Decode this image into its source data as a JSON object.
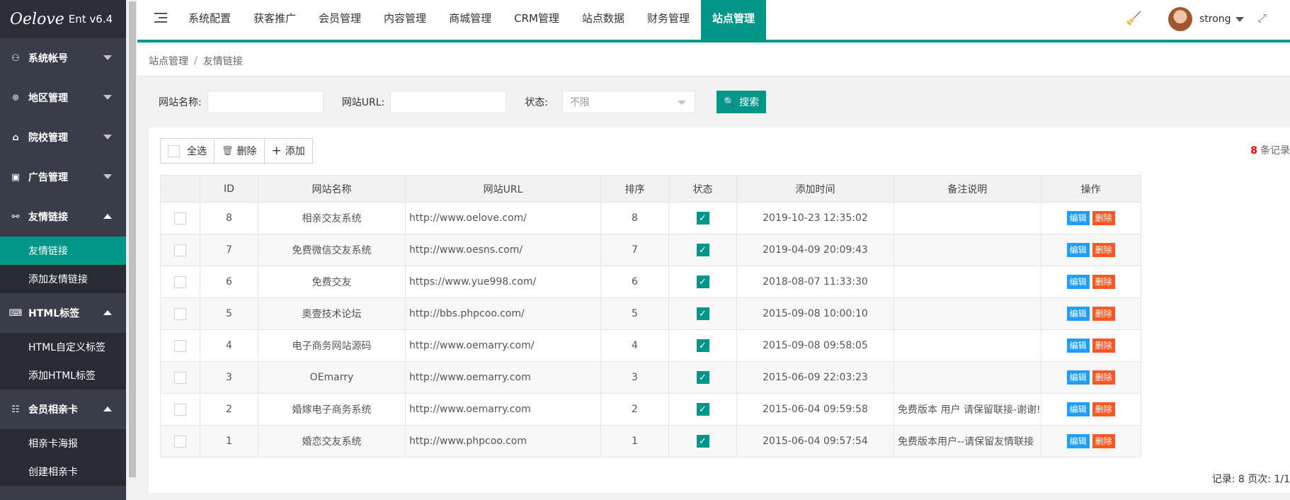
{
  "logo": {
    "mark": "Oelove",
    "version": "Ent v6.4"
  },
  "sidebar": {
    "groups": [
      {
        "label": "系统帐号",
        "icon": "user-icon",
        "expanded": false,
        "items": []
      },
      {
        "label": "地区管理",
        "icon": "location-icon",
        "expanded": false,
        "items": []
      },
      {
        "label": "院校管理",
        "icon": "school-icon",
        "expanded": false,
        "items": []
      },
      {
        "label": "广告管理",
        "icon": "ad-icon",
        "expanded": false,
        "items": []
      },
      {
        "label": "友情链接",
        "icon": "link-icon",
        "expanded": true,
        "items": [
          {
            "label": "友情链接",
            "active": true
          },
          {
            "label": "添加友情链接",
            "active": false
          }
        ]
      },
      {
        "label": "HTML标签",
        "icon": "code-icon",
        "expanded": true,
        "items": [
          {
            "label": "HTML自定义标签",
            "active": false
          },
          {
            "label": "添加HTML标签",
            "active": false
          }
        ]
      },
      {
        "label": "会员相亲卡",
        "icon": "id-card-icon",
        "expanded": true,
        "items": [
          {
            "label": "相亲卡海报",
            "active": false
          },
          {
            "label": "创建相亲卡",
            "active": false
          }
        ]
      }
    ]
  },
  "header": {
    "nav": [
      {
        "label": "系统配置",
        "active": false
      },
      {
        "label": "获客推广",
        "active": false
      },
      {
        "label": "会员管理",
        "active": false
      },
      {
        "label": "内容管理",
        "active": false
      },
      {
        "label": "商城管理",
        "active": false
      },
      {
        "label": "CRM管理",
        "active": false
      },
      {
        "label": "站点数据",
        "active": false
      },
      {
        "label": "财务管理",
        "active": false
      },
      {
        "label": "站点管理",
        "active": true
      }
    ],
    "username": "strong",
    "accent": "#009688"
  },
  "breadcrumb": {
    "parent": "站点管理",
    "separator": "/",
    "current": "友情链接"
  },
  "search": {
    "name_label": "网站名称:",
    "name_value": "",
    "url_label": "网站URL:",
    "url_value": "",
    "status_label": "状态:",
    "status_value": "不限",
    "button_label": "搜索"
  },
  "toolbar": {
    "select_all": "全选",
    "delete": "删除",
    "add": "添加"
  },
  "record_count": {
    "num": "8",
    "suffix": "条记录"
  },
  "table": {
    "columns": [
      "",
      "ID",
      "网站名称",
      "网站URL",
      "排序",
      "状态",
      "添加时间",
      "备注说明",
      "操作"
    ],
    "edit_label": "编辑",
    "delete_label": "删除",
    "rows": [
      {
        "id": "8",
        "name": "相亲交友系统",
        "url": "http://www.oelove.com/",
        "order": "8",
        "status": true,
        "time": "2019-10-23 12:35:02",
        "remark": ""
      },
      {
        "id": "7",
        "name": "免费微信交友系统",
        "url": "http://www.oesns.com/",
        "order": "7",
        "status": true,
        "time": "2019-04-09 20:09:43",
        "remark": ""
      },
      {
        "id": "6",
        "name": "免费交友",
        "url": "https://www.yue998.com/",
        "order": "6",
        "status": true,
        "time": "2018-08-07 11:33:30",
        "remark": ""
      },
      {
        "id": "5",
        "name": "奥壹技术论坛",
        "url": "http://bbs.phpcoo.com/",
        "order": "5",
        "status": true,
        "time": "2015-09-08 10:00:10",
        "remark": ""
      },
      {
        "id": "4",
        "name": "电子商务网站源码",
        "url": "http://www.oemarry.com/",
        "order": "4",
        "status": true,
        "time": "2015-09-08 09:58:05",
        "remark": ""
      },
      {
        "id": "3",
        "name": "OEmarry",
        "url": "http://www.oemarry.com",
        "order": "3",
        "status": true,
        "time": "2015-06-09 22:03:23",
        "remark": ""
      },
      {
        "id": "2",
        "name": "婚嫁电子商务系统",
        "url": "http://www.oemarry.com",
        "order": "2",
        "status": true,
        "time": "2015-06-04 09:59:58",
        "remark": "免费版本 用户 请保留联接-谢谢!"
      },
      {
        "id": "1",
        "name": "婚恋交友系统",
        "url": "http://www.phpcoo.com",
        "order": "1",
        "status": true,
        "time": "2015-06-04 09:57:54",
        "remark": "免费版本用户--请保留友情联接"
      }
    ]
  },
  "pager": {
    "text": "记录: 8  页次: 1/1"
  }
}
